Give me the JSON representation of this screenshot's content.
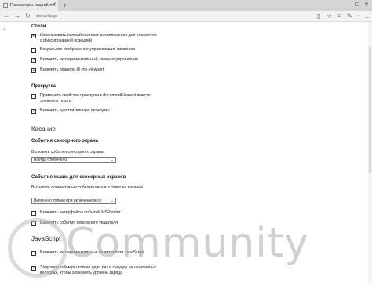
{
  "tab": {
    "title": "Параметры разработч"
  },
  "address": {
    "url": "about:flags"
  },
  "sections": {
    "styles": {
      "heading": "Стили",
      "items": [
        {
          "label": "Использовать полный контекст расположения для элементов с фиксированной позицией",
          "checked": true
        },
        {
          "label": "Визуальное отображение управляющих символов",
          "checked": false
        },
        {
          "label": "Включить экспериментальный элемент управления",
          "checked": true
        },
        {
          "label": "Включить правила @-ms-viewport",
          "checked": true
        }
      ]
    },
    "scroll": {
      "heading": "Прокрутка",
      "items": [
        {
          "label": "Применить свойства прокрутки к documentElement вместо элемента текста",
          "checked": false
        },
        {
          "label": "Включить чувствительную прокрутку",
          "checked": true
        }
      ]
    },
    "touch": {
      "heading": "Касание",
      "events_heading": "События сенсорного экрана",
      "events_label": "Включить события сенсорного экрана",
      "events_select": "Всегда отключено",
      "mouse_heading": "События мыши для сенсорных экранов",
      "mouse_label": "Вызывать совместимые события мыши в ответ на касание",
      "mouse_select": "Включено только при включенном се",
      "items": [
        {
          "label": "Включить интерфейсы событий MSPointer",
          "checked": false
        },
        {
          "label": "Включить события сенсорного указателя",
          "checked": false
        }
      ]
    },
    "js": {
      "heading": "JavaScript",
      "items": [
        {
          "label": "Включить экспериментальные возможности JavaScript",
          "checked": false
        },
        {
          "label": "Запускать таймеры только один раз в секунду на неактивных вкладках, чтобы экономить уровень заряда",
          "checked": true
        }
      ]
    }
  },
  "watermark": {
    "text": "Community"
  },
  "colors": {
    "tabbar": "#d5d5d5",
    "navbar": "#f2f2f2",
    "background": "#ffffff"
  }
}
